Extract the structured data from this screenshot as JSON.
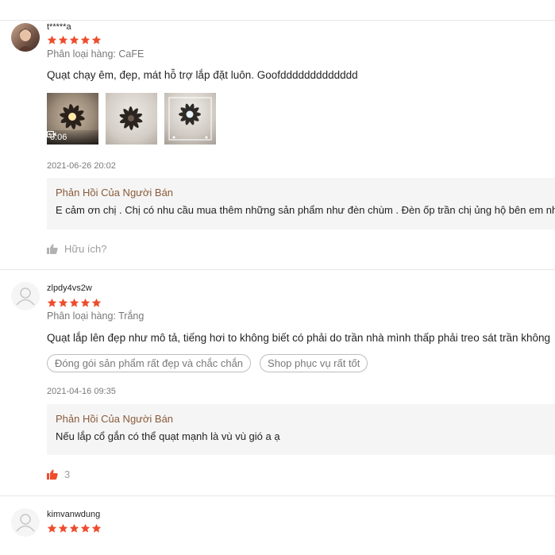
{
  "colors": {
    "star": "#ee4d2d",
    "reply_title": "#8a5a3a",
    "helpful_active": "#ee4d2d"
  },
  "reviews": [
    {
      "username": "t*****a",
      "rating": 5,
      "variant": "Phân loại hàng: CaFE",
      "content": "Quạt chạy êm, đẹp, mát hỗ trợ lắp đặt luôn. Goofddddddddddddd",
      "media": [
        {
          "type": "video",
          "duration": "0:06",
          "icon": "video-camera-icon"
        },
        {
          "type": "image"
        },
        {
          "type": "image"
        }
      ],
      "date": "2021-06-26 20:02",
      "reply": {
        "title": "Phản Hồi Của Người Bán",
        "text": "E cảm ơn chị . Chị có nhu cầu mua thêm những sản phẩm như đèn chùm . Đèn ốp trần chị ủng hộ bên em nhé"
      },
      "helpful": {
        "label": "Hữu ích?",
        "icon": "thumbs-up-icon",
        "active": false
      }
    },
    {
      "username": "zlpdy4vs2w",
      "rating": 5,
      "variant": "Phân loại hàng: Trắng",
      "content": "Quạt lắp lên đẹp như mô tả, tiếng hơi to không biết có phải do trần nhà mình thấp phải treo sát trần không",
      "tags": [
        "Đóng gói sản phẩm rất đẹp và chắc chắn",
        "Shop phục vụ rất tốt"
      ],
      "date": "2021-04-16 09:35",
      "reply": {
        "title": "Phản Hồi Của Người Bán",
        "text": "Nếu lắp cổ gắn có thể quạt mạnh là vù vù gió a ạ"
      },
      "helpful": {
        "label": "3",
        "icon": "thumbs-up-icon",
        "active": true
      }
    },
    {
      "username": "kimvanwdung",
      "rating": 5
    }
  ]
}
